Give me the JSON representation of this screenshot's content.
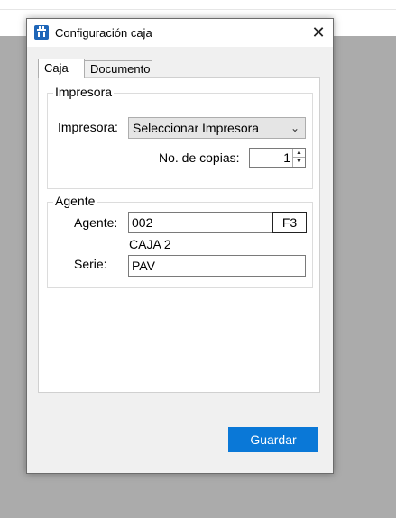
{
  "window": {
    "title": "Configuración caja",
    "close_glyph": "✕",
    "icon": "cash-register-icon"
  },
  "tabs": [
    {
      "label": "Caja",
      "active": true
    },
    {
      "label": "Documento",
      "active": false
    }
  ],
  "impresora_group": {
    "legend": "Impresora",
    "printer_label": "Impresora:",
    "printer_value": "Seleccionar Impresora",
    "copies_label": "No. de copias:",
    "copies_value": "1"
  },
  "agente_group": {
    "legend": "Agente",
    "agent_label": "Agente:",
    "agent_value": "002",
    "f3_label": "F3",
    "agent_name": "CAJA 2",
    "serie_label": "Serie:",
    "serie_value": "PAV"
  },
  "footer": {
    "save_label": "Guardar"
  },
  "colors": {
    "accent": "#0a78d7",
    "backdrop": "#ababab"
  }
}
